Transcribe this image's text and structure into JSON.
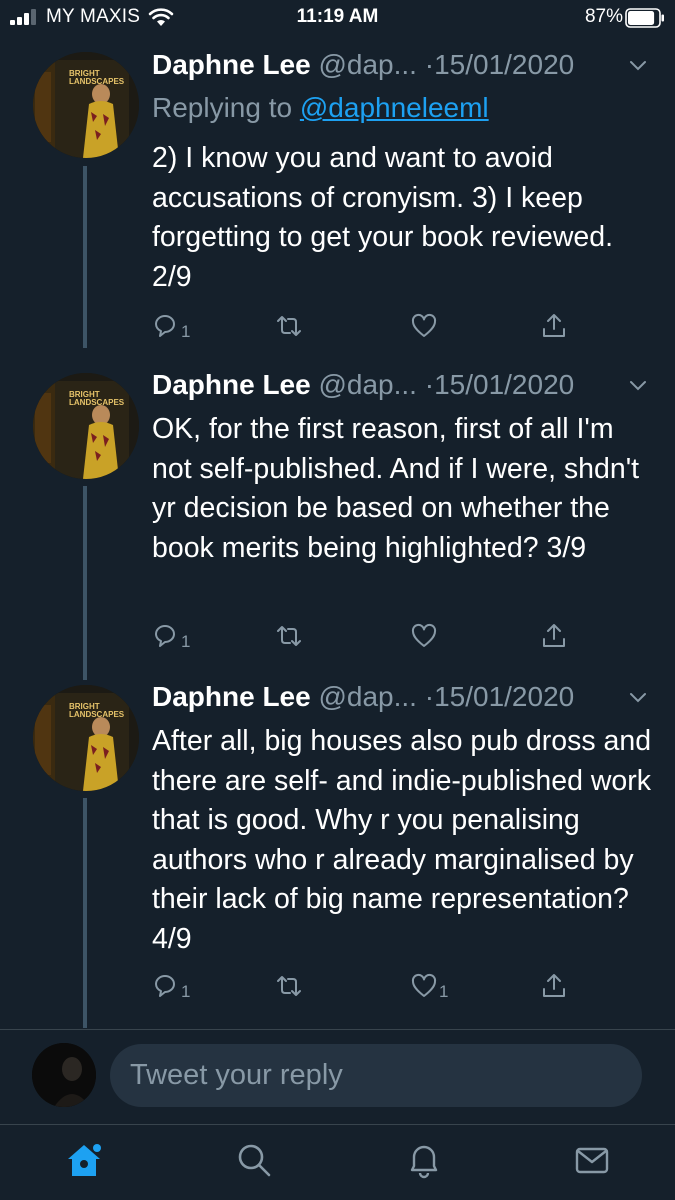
{
  "status_bar": {
    "carrier": "MY MAXIS",
    "time": "11:19 AM",
    "battery_percent": "87%",
    "battery_level": 0.87,
    "icons": [
      "signal-icon",
      "wifi-icon",
      "battery-icon"
    ]
  },
  "tweets": [
    {
      "name": "Daphne Lee",
      "handle": "@dap...",
      "separator": "·",
      "date": "15/01/2020",
      "replying_prefix": "Replying to ",
      "replying_handle": "@daphneleeml",
      "text": "2) I know you and want to avoid accusations of cronyism. 3) I keep forgetting to get your book reviewed. 2/9",
      "reply_count": "1",
      "retweet_count": "",
      "like_count": ""
    },
    {
      "name": "Daphne Lee",
      "handle": "@dap...",
      "separator": "·",
      "date": "15/01/2020",
      "text": "OK, for the first reason, first of all I'm not self-published. And if I were, shdn't yr decision be based on whether the book merits being highlighted? 3/9",
      "reply_count": "1",
      "retweet_count": "",
      "like_count": ""
    },
    {
      "name": "Daphne Lee",
      "handle": "@dap...",
      "separator": "·",
      "date": "15/01/2020",
      "text": "After all, big houses also pub dross and there are self- and indie-published work that is good. Why r you penalising authors who r already marginalised by their lack of big name representation? 4/9",
      "reply_count": "1",
      "retweet_count": "",
      "like_count": "1"
    }
  ],
  "reply_box": {
    "placeholder": "Tweet your reply"
  },
  "tab_bar": {
    "items": [
      "home-icon",
      "search-icon",
      "notifications-icon",
      "messages-icon"
    ],
    "active": "home-icon"
  },
  "colors": {
    "background": "#15202b",
    "accent": "#1da1f2",
    "muted_text": "#8899a6",
    "divider": "#38444d"
  }
}
